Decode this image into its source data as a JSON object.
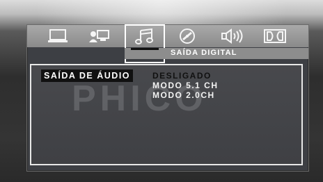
{
  "menu": {
    "icons": [
      {
        "name": "monitor-icon"
      },
      {
        "name": "user-screen-icon"
      },
      {
        "name": "music-note-icon",
        "selected": true
      },
      {
        "name": "disc-icon"
      },
      {
        "name": "speaker-icon"
      },
      {
        "name": "dolby-icon"
      }
    ],
    "section_title": "SAÍDA DIGITAL"
  },
  "setting": {
    "label": "SAÍDA DE ÁUDIO",
    "options": [
      {
        "text": "DESLIGADO",
        "selected": true
      },
      {
        "text": "MODO 5.1 CH",
        "selected": false
      },
      {
        "text": "MODO 2.0CH",
        "selected": false
      }
    ]
  },
  "watermark": "PHICO",
  "colors": {
    "highlight_text": "#111111",
    "option_text": "#f2f2f2",
    "panel": "#3d3f44"
  }
}
